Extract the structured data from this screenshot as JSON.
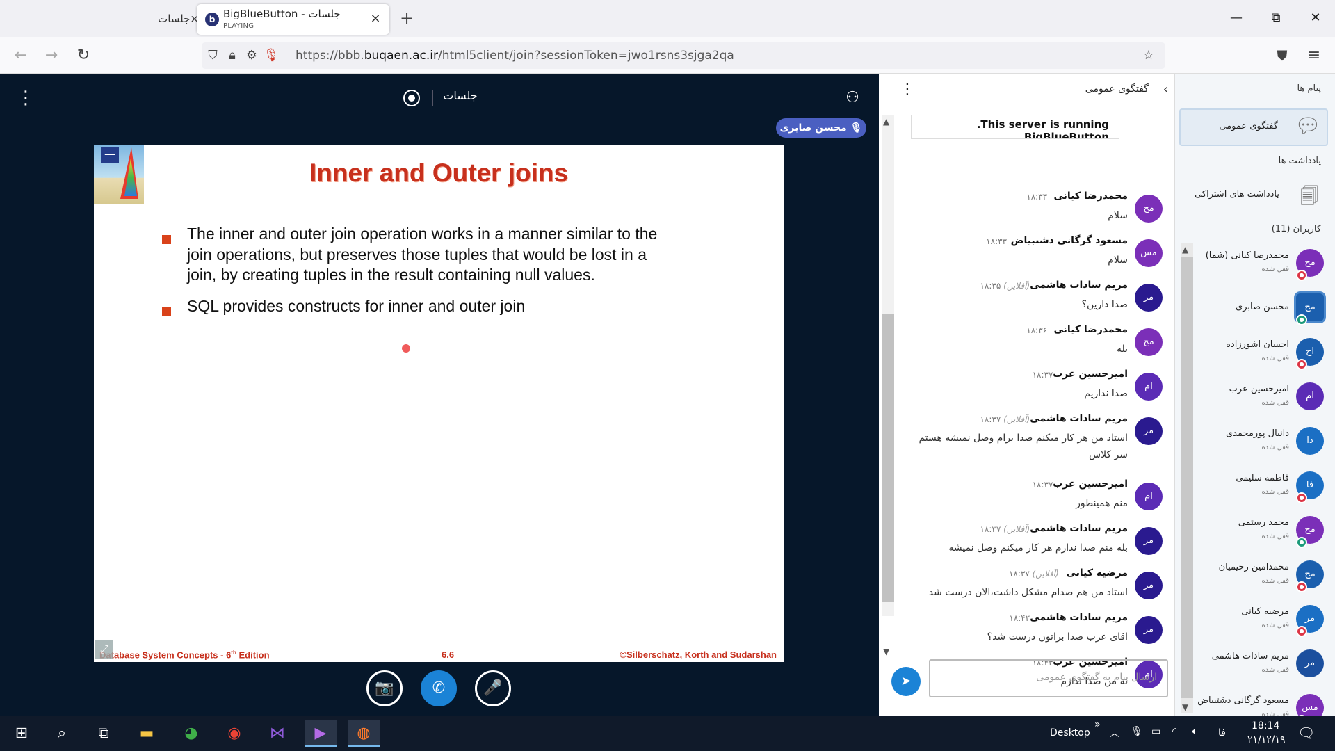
{
  "browser": {
    "inactive_tab": "×جلسات",
    "active_tab_title": "BigBlueButton - جلسات",
    "active_tab_sub": "PLAYING",
    "favicon": "b",
    "tab_close": "×",
    "new_tab": "+",
    "window": {
      "minimize": "—",
      "restore": "⧉",
      "close": "✕"
    },
    "url_prefix": "https://bbb.",
    "url_domain": "buqaen.ac.ir",
    "url_rest": "/html5client/join?sessionToken=jwo1rsns3sjga2qa"
  },
  "stage": {
    "meeting_title": "جلسات",
    "talker": "محسن صابری",
    "menu_glyph": "⋮",
    "user_glyph": "👤"
  },
  "slide": {
    "title": "Inner and Outer joins",
    "bullets": [
      "The inner and outer join operation works in a manner similar to the join operations, but preserves those tuples that would be lost in a join, by creating tuples in the result containing null values.",
      "SQL provides constructs for inner and outer join"
    ],
    "footer_left_prefix": "Database System Concepts - 6",
    "footer_left_sup": "th",
    "footer_left_suffix": " Edition",
    "footer_center": "6.6",
    "footer_right": "©Silberschatz, Korth and Sudarshan",
    "thumb_minus": "—"
  },
  "controls": {
    "video": "📷",
    "call": "✆",
    "mic": "🎤"
  },
  "chat": {
    "header": "گفتگوی عمومی",
    "back": "‹",
    "kebab": "⋮",
    "welcome_prefix": ".This server is running ",
    "welcome_link": "BigBlueButton",
    "input_placeholder": "ارسال پیام به گفتگوی عمومی",
    "send": "➤",
    "messages": [
      {
        "initials": "مح",
        "name": "محمدرضا کیانی",
        "time": "۱۸:۳۳",
        "text": "سلام",
        "color": "#7b2fb8"
      },
      {
        "initials": "مس",
        "name": "مسعود گرگانی دشتبیاض",
        "time": "۱۸:۳۳",
        "text": "سلام",
        "color": "#7b2fb8"
      },
      {
        "initials": "مر",
        "name": "مریم سادات هاشمی",
        "status": "(آفلاین)",
        "time": "۱۸:۳۵",
        "text": "صدا دارین؟",
        "color": "#2a1a8f"
      },
      {
        "initials": "مح",
        "name": "محمدرضا کیانی",
        "time": "۱۸:۳۶",
        "text": "بله",
        "color": "#7b2fb8"
      },
      {
        "initials": "ام",
        "name": "امیرحسین عرب",
        "time": "۱۸:۳۷",
        "text": "صدا نداریم",
        "color": "#5b2bb5"
      },
      {
        "initials": "مر",
        "name": "مریم سادات هاشمی",
        "status": "(آفلاین)",
        "time": "۱۸:۳۷",
        "text": "استاد من هر کار میکنم صدا برام وصل نمیشه هستم سر کلاس",
        "color": "#2a1a8f"
      },
      {
        "initials": "ام",
        "name": "امیرحسین عرب",
        "time": "۱۸:۳۷",
        "text": "منم همینطور",
        "color": "#5b2bb5"
      },
      {
        "initials": "مر",
        "name": "مریم سادات هاشمی",
        "status": "(آفلاین)",
        "time": "۱۸:۳۷",
        "text": "بله منم صدا ندارم هر کار میکنم وصل نمیشه",
        "color": "#2a1a8f"
      },
      {
        "initials": "مر",
        "name": "مرضیه کیانی",
        "status": "(آفلاین)",
        "time": "۱۸:۳۷",
        "text": "استاد من هم صدام مشکل داشت،الان درست شد",
        "color": "#2a1a8f"
      },
      {
        "initials": "مر",
        "name": "مریم سادات هاشمی",
        "time": "۱۸:۴۲",
        "text": "اقای عرب صدا براتون درست شد؟",
        "color": "#2a1a8f"
      },
      {
        "initials": "ام",
        "name": "امیرحسین عرب",
        "time": "۱۸:۴۳",
        "text": "نه من صدا ندارم",
        "color": "#5b2bb5"
      }
    ]
  },
  "sidebar": {
    "messages_title": "پیام ها",
    "public_chat": "گفتگوی عمومی",
    "notes_title": "یادداشت ها",
    "shared_notes": "یادداشت های اشتراکی",
    "users_title": "کاربران (11)",
    "users": [
      {
        "initials": "مح",
        "name": "محمدرضا کیانی (شما)",
        "status": "قفل شده",
        "color": "#7b2fb8",
        "badge": "red"
      },
      {
        "initials": "مح",
        "name": "محسن صابری",
        "status": "",
        "color": "#1b5fae",
        "badge": "green",
        "presenter": true
      },
      {
        "initials": "اح",
        "name": "احسان اشورزاده",
        "status": "قفل شده",
        "color": "#1b5fae",
        "badge": "red"
      },
      {
        "initials": "ام",
        "name": "امیرحسین عرب",
        "status": "قفل شده",
        "color": "#5b2bb5",
        "badge": ""
      },
      {
        "initials": "دا",
        "name": "دانیال پورمحمدی",
        "status": "قفل شده",
        "color": "#1b6fc4",
        "badge": ""
      },
      {
        "initials": "فا",
        "name": "فاطمه سلیمی",
        "status": "قفل شده",
        "color": "#1b6fc4",
        "badge": "red"
      },
      {
        "initials": "مح",
        "name": "محمد رستمی",
        "status": "قفل شده",
        "color": "#7b2fb8",
        "badge": "green"
      },
      {
        "initials": "مح",
        "name": "محمدامین رحیمیان",
        "status": "قفل شده",
        "color": "#1b5fae",
        "badge": "red"
      },
      {
        "initials": "مر",
        "name": "مرضیه کیانی",
        "status": "قفل شده",
        "color": "#1b6fc4",
        "badge": "red"
      },
      {
        "initials": "مر",
        "name": "مریم سادات هاشمی",
        "status": "قفل شده",
        "color": "#1b4f9e",
        "badge": ""
      },
      {
        "initials": "مس",
        "name": "مسعود گرگانی دشتبیاض",
        "status": "قفل شده",
        "color": "#7b2fb8",
        "badge": "red"
      }
    ]
  },
  "taskbar": {
    "desktop": "Desktop",
    "chevron": "»",
    "lang": "فا",
    "time": "18:14",
    "date": "۲۱/۱۲/۱۹"
  }
}
